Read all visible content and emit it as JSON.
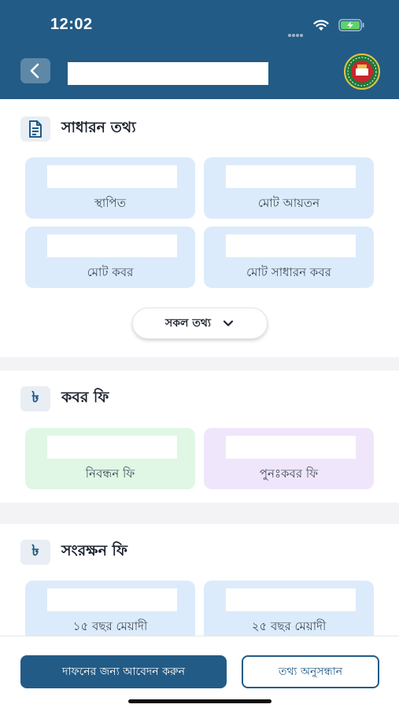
{
  "status_bar": {
    "time": "12:02"
  },
  "header": {
    "back_icon": "chevron-left-icon",
    "logo_icon": "emblem-logo"
  },
  "general_info": {
    "title": "সাধারন তথ্য",
    "icon": "document-icon",
    "cards": [
      {
        "label": "স্থাপিত"
      },
      {
        "label": "মোট আয়তন"
      },
      {
        "label": "মোট কবর"
      },
      {
        "label": "মোট সাধারন কবর"
      }
    ],
    "more_label": "সকল তথ্য"
  },
  "grave_fee": {
    "title": "কবর ফি",
    "icon_glyph": "৳",
    "cards": [
      {
        "label": "নিবন্ধন ফি"
      },
      {
        "label": "পুনঃকবর ফি"
      }
    ]
  },
  "preservation_fee": {
    "title": "সংরক্ষন ফি",
    "icon_glyph": "৳",
    "cards": [
      {
        "label": "১৫ বছর মেয়াদী"
      },
      {
        "label": "২৫ বছর মেয়াদী"
      }
    ]
  },
  "bottom": {
    "apply_label": "দাফনের জন্য আবেদন করুন",
    "search_label": "তথ্য অনুসন্ধান"
  },
  "colors": {
    "primary": "#225b86",
    "card_blue": "#dcebfb",
    "card_green": "#dff7e4",
    "card_purple": "#f0e6fb"
  }
}
